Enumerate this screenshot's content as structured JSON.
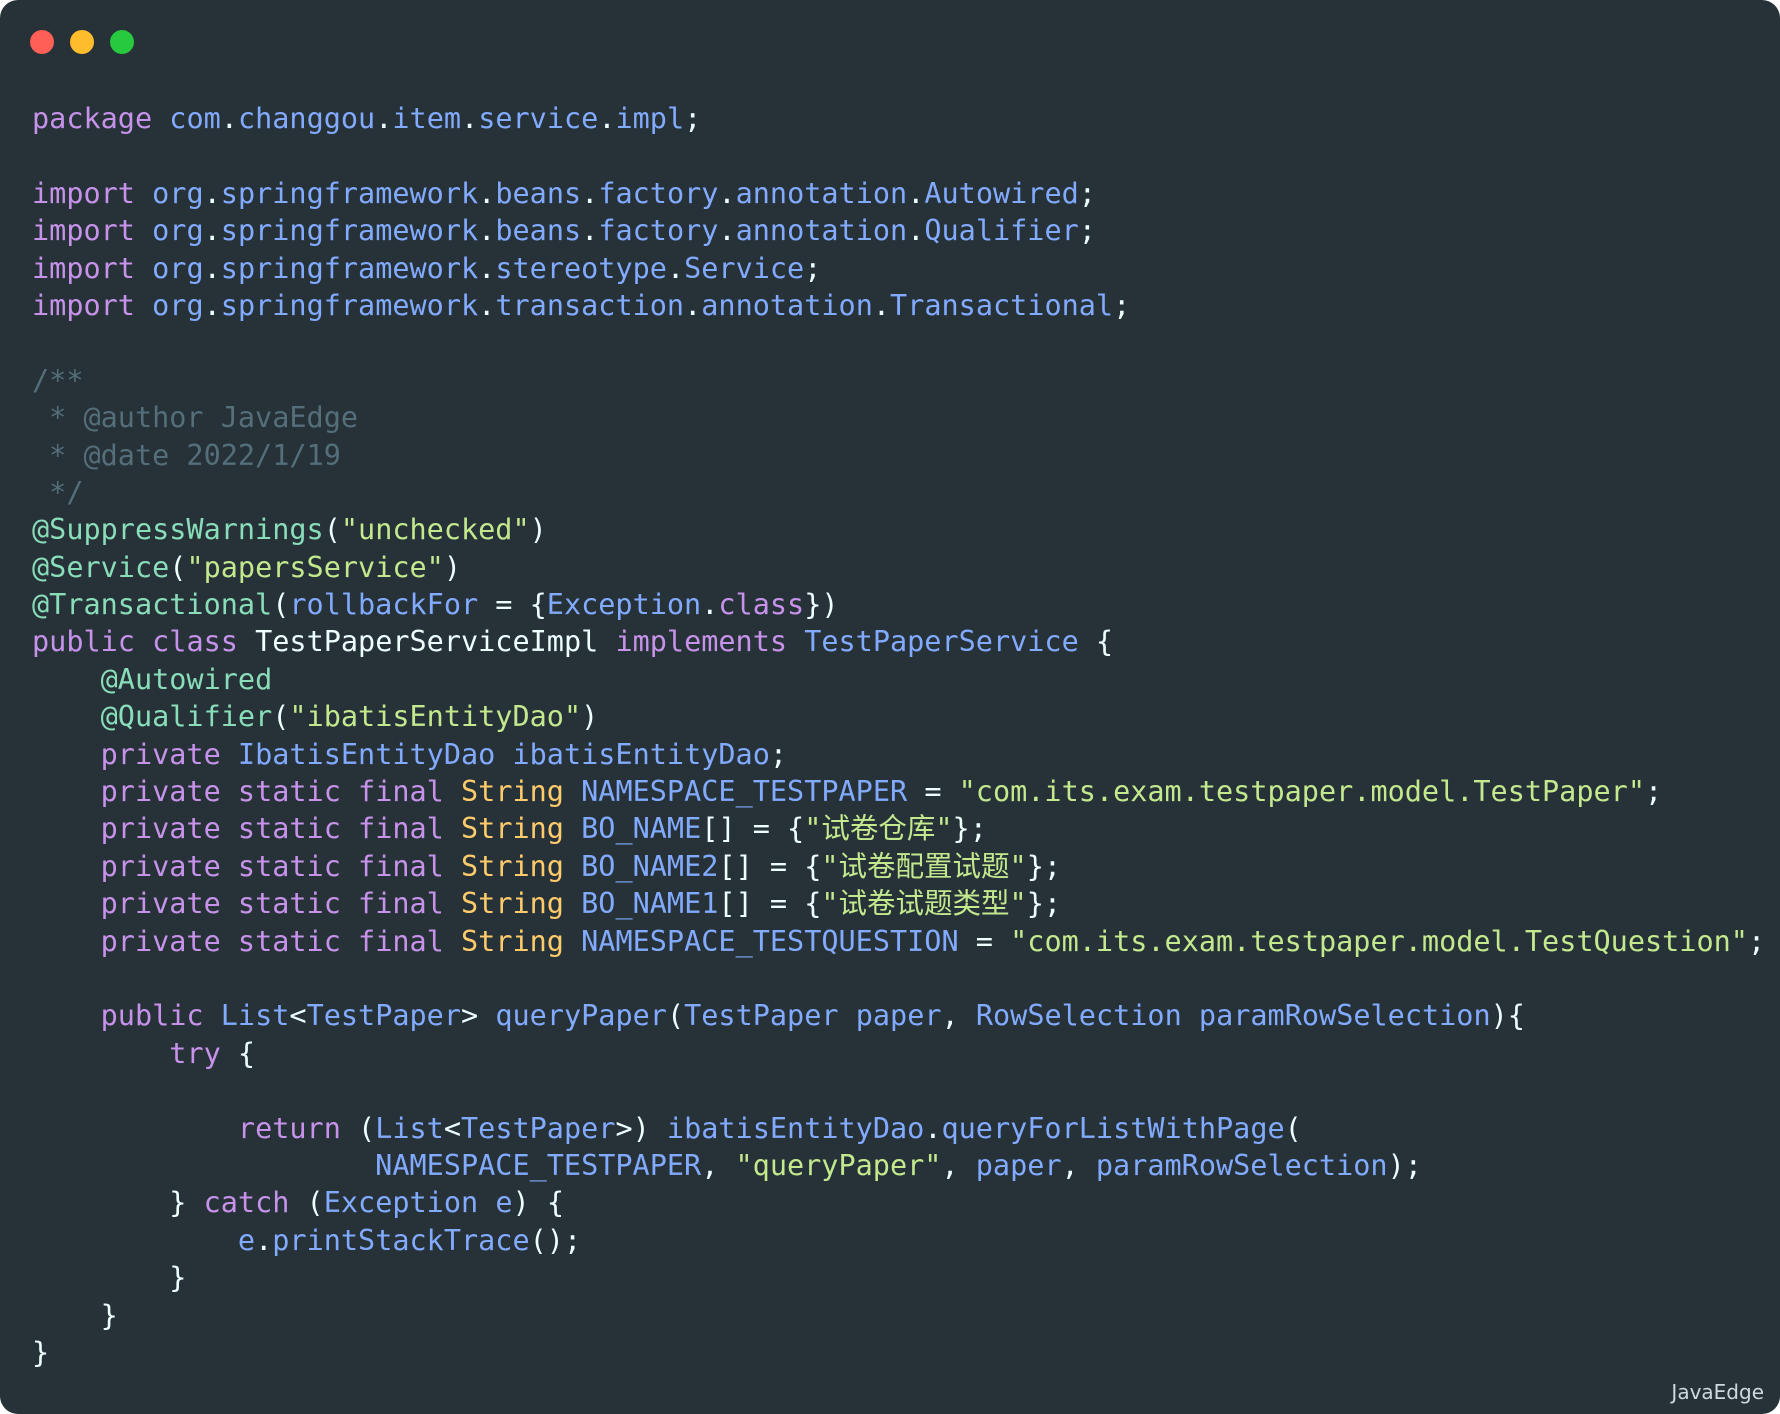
{
  "window": {
    "controls": [
      "close",
      "minimize",
      "maximize"
    ],
    "colors": {
      "background": "#263238",
      "close": "#ff5f56",
      "minimize": "#ffbd2e",
      "maximize": "#27c93f"
    }
  },
  "code": {
    "language": "java",
    "lines": [
      [
        [
          "kw",
          "package"
        ],
        [
          "p",
          " "
        ],
        [
          "pk",
          "com"
        ],
        [
          "p",
          "."
        ],
        [
          "pk",
          "changgou"
        ],
        [
          "p",
          "."
        ],
        [
          "pk",
          "item"
        ],
        [
          "p",
          "."
        ],
        [
          "pk",
          "service"
        ],
        [
          "p",
          "."
        ],
        [
          "pk",
          "impl"
        ],
        [
          "p",
          ";"
        ]
      ],
      [],
      [
        [
          "kw",
          "import"
        ],
        [
          "p",
          " "
        ],
        [
          "pk",
          "org"
        ],
        [
          "p",
          "."
        ],
        [
          "pk",
          "springframework"
        ],
        [
          "p",
          "."
        ],
        [
          "pk",
          "beans"
        ],
        [
          "p",
          "."
        ],
        [
          "pk",
          "factory"
        ],
        [
          "p",
          "."
        ],
        [
          "pk",
          "annotation"
        ],
        [
          "p",
          "."
        ],
        [
          "pk",
          "Autowired"
        ],
        [
          "p",
          ";"
        ]
      ],
      [
        [
          "kw",
          "import"
        ],
        [
          "p",
          " "
        ],
        [
          "pk",
          "org"
        ],
        [
          "p",
          "."
        ],
        [
          "pk",
          "springframework"
        ],
        [
          "p",
          "."
        ],
        [
          "pk",
          "beans"
        ],
        [
          "p",
          "."
        ],
        [
          "pk",
          "factory"
        ],
        [
          "p",
          "."
        ],
        [
          "pk",
          "annotation"
        ],
        [
          "p",
          "."
        ],
        [
          "pk",
          "Qualifier"
        ],
        [
          "p",
          ";"
        ]
      ],
      [
        [
          "kw",
          "import"
        ],
        [
          "p",
          " "
        ],
        [
          "pk",
          "org"
        ],
        [
          "p",
          "."
        ],
        [
          "pk",
          "springframework"
        ],
        [
          "p",
          "."
        ],
        [
          "pk",
          "stereotype"
        ],
        [
          "p",
          "."
        ],
        [
          "pk",
          "Service"
        ],
        [
          "p",
          ";"
        ]
      ],
      [
        [
          "kw",
          "import"
        ],
        [
          "p",
          " "
        ],
        [
          "pk",
          "org"
        ],
        [
          "p",
          "."
        ],
        [
          "pk",
          "springframework"
        ],
        [
          "p",
          "."
        ],
        [
          "pk",
          "transaction"
        ],
        [
          "p",
          "."
        ],
        [
          "pk",
          "annotation"
        ],
        [
          "p",
          "."
        ],
        [
          "pk",
          "Transactional"
        ],
        [
          "p",
          ";"
        ]
      ],
      [],
      [
        [
          "cm",
          "/**"
        ]
      ],
      [
        [
          "cm",
          " * @author JavaEdge"
        ]
      ],
      [
        [
          "cm",
          " * @date 2022/1/19"
        ]
      ],
      [
        [
          "cm",
          " */"
        ]
      ],
      [
        [
          "an",
          "@SuppressWarnings"
        ],
        [
          "p",
          "("
        ],
        [
          "st",
          "\"unchecked\""
        ],
        [
          "p",
          ")"
        ]
      ],
      [
        [
          "an",
          "@Service"
        ],
        [
          "p",
          "("
        ],
        [
          "st",
          "\"papersService\""
        ],
        [
          "p",
          ")"
        ]
      ],
      [
        [
          "an",
          "@Transactional"
        ],
        [
          "p",
          "("
        ],
        [
          "id",
          "rollbackFor"
        ],
        [
          "p",
          " = {"
        ],
        [
          "id",
          "Exception"
        ],
        [
          "p",
          "."
        ],
        [
          "kw",
          "class"
        ],
        [
          "p",
          "})"
        ]
      ],
      [
        [
          "kw",
          "public"
        ],
        [
          "p",
          " "
        ],
        [
          "kw",
          "class"
        ],
        [
          "p",
          " "
        ],
        [
          "cl",
          "TestPaperServiceImpl"
        ],
        [
          "p",
          " "
        ],
        [
          "kw",
          "implements"
        ],
        [
          "p",
          " "
        ],
        [
          "id",
          "TestPaperService"
        ],
        [
          "p",
          " {"
        ]
      ],
      [
        [
          "p",
          "    "
        ],
        [
          "an",
          "@Autowired"
        ]
      ],
      [
        [
          "p",
          "    "
        ],
        [
          "an",
          "@Qualifier"
        ],
        [
          "p",
          "("
        ],
        [
          "st",
          "\"ibatisEntityDao\""
        ],
        [
          "p",
          ")"
        ]
      ],
      [
        [
          "p",
          "    "
        ],
        [
          "kw",
          "private"
        ],
        [
          "p",
          " "
        ],
        [
          "id",
          "IbatisEntityDao"
        ],
        [
          "p",
          " "
        ],
        [
          "id",
          "ibatisEntityDao"
        ],
        [
          "p",
          ";"
        ]
      ],
      [
        [
          "p",
          "    "
        ],
        [
          "kw",
          "private"
        ],
        [
          "p",
          " "
        ],
        [
          "kw",
          "static"
        ],
        [
          "p",
          " "
        ],
        [
          "kw",
          "final"
        ],
        [
          "p",
          " "
        ],
        [
          "ty",
          "String"
        ],
        [
          "p",
          " "
        ],
        [
          "id",
          "NAMESPACE_TESTPAPER"
        ],
        [
          "p",
          " = "
        ],
        [
          "st",
          "\"com.its.exam.testpaper.model.TestPaper\""
        ],
        [
          "p",
          ";"
        ]
      ],
      [
        [
          "p",
          "    "
        ],
        [
          "kw",
          "private"
        ],
        [
          "p",
          " "
        ],
        [
          "kw",
          "static"
        ],
        [
          "p",
          " "
        ],
        [
          "kw",
          "final"
        ],
        [
          "p",
          " "
        ],
        [
          "ty",
          "String"
        ],
        [
          "p",
          " "
        ],
        [
          "id",
          "BO_NAME"
        ],
        [
          "p",
          "[] = {"
        ],
        [
          "st",
          "\"试卷仓库\""
        ],
        [
          "p",
          "};"
        ]
      ],
      [
        [
          "p",
          "    "
        ],
        [
          "kw",
          "private"
        ],
        [
          "p",
          " "
        ],
        [
          "kw",
          "static"
        ],
        [
          "p",
          " "
        ],
        [
          "kw",
          "final"
        ],
        [
          "p",
          " "
        ],
        [
          "ty",
          "String"
        ],
        [
          "p",
          " "
        ],
        [
          "id",
          "BO_NAME2"
        ],
        [
          "p",
          "[] = {"
        ],
        [
          "st",
          "\"试卷配置试题\""
        ],
        [
          "p",
          "};"
        ]
      ],
      [
        [
          "p",
          "    "
        ],
        [
          "kw",
          "private"
        ],
        [
          "p",
          " "
        ],
        [
          "kw",
          "static"
        ],
        [
          "p",
          " "
        ],
        [
          "kw",
          "final"
        ],
        [
          "p",
          " "
        ],
        [
          "ty",
          "String"
        ],
        [
          "p",
          " "
        ],
        [
          "id",
          "BO_NAME1"
        ],
        [
          "p",
          "[] = {"
        ],
        [
          "st",
          "\"试卷试题类型\""
        ],
        [
          "p",
          "};"
        ]
      ],
      [
        [
          "p",
          "    "
        ],
        [
          "kw",
          "private"
        ],
        [
          "p",
          " "
        ],
        [
          "kw",
          "static"
        ],
        [
          "p",
          " "
        ],
        [
          "kw",
          "final"
        ],
        [
          "p",
          " "
        ],
        [
          "ty",
          "String"
        ],
        [
          "p",
          " "
        ],
        [
          "id",
          "NAMESPACE_TESTQUESTION"
        ],
        [
          "p",
          " = "
        ],
        [
          "st",
          "\"com.its.exam.testpaper.model.TestQuestion\""
        ],
        [
          "p",
          ";"
        ]
      ],
      [],
      [
        [
          "p",
          "    "
        ],
        [
          "kw",
          "public"
        ],
        [
          "p",
          " "
        ],
        [
          "id",
          "List"
        ],
        [
          "p",
          "<"
        ],
        [
          "id",
          "TestPaper"
        ],
        [
          "p",
          "> "
        ],
        [
          "id",
          "queryPaper"
        ],
        [
          "p",
          "("
        ],
        [
          "id",
          "TestPaper"
        ],
        [
          "p",
          " "
        ],
        [
          "id",
          "paper"
        ],
        [
          "p",
          ", "
        ],
        [
          "id",
          "RowSelection"
        ],
        [
          "p",
          " "
        ],
        [
          "id",
          "paramRowSelection"
        ],
        [
          "p",
          "){"
        ]
      ],
      [
        [
          "p",
          "        "
        ],
        [
          "kw",
          "try"
        ],
        [
          "p",
          " {"
        ]
      ],
      [],
      [
        [
          "p",
          "            "
        ],
        [
          "kw",
          "return"
        ],
        [
          "p",
          " ("
        ],
        [
          "id",
          "List"
        ],
        [
          "p",
          "<"
        ],
        [
          "id",
          "TestPaper"
        ],
        [
          "p",
          ">) "
        ],
        [
          "id",
          "ibatisEntityDao"
        ],
        [
          "p",
          "."
        ],
        [
          "id",
          "queryForListWithPage"
        ],
        [
          "p",
          "("
        ]
      ],
      [
        [
          "p",
          "                    "
        ],
        [
          "id",
          "NAMESPACE_TESTPAPER"
        ],
        [
          "p",
          ", "
        ],
        [
          "st",
          "\"queryPaper\""
        ],
        [
          "p",
          ", "
        ],
        [
          "id",
          "paper"
        ],
        [
          "p",
          ", "
        ],
        [
          "id",
          "paramRowSelection"
        ],
        [
          "p",
          ");"
        ]
      ],
      [
        [
          "p",
          "        } "
        ],
        [
          "kw",
          "catch"
        ],
        [
          "p",
          " ("
        ],
        [
          "id",
          "Exception"
        ],
        [
          "p",
          " "
        ],
        [
          "id",
          "e"
        ],
        [
          "p",
          ") {"
        ]
      ],
      [
        [
          "p",
          "            "
        ],
        [
          "id",
          "e"
        ],
        [
          "p",
          "."
        ],
        [
          "id",
          "printStackTrace"
        ],
        [
          "p",
          "();"
        ]
      ],
      [
        [
          "p",
          "        }"
        ]
      ],
      [
        [
          "p",
          "    }"
        ]
      ],
      [
        [
          "p",
          "}"
        ]
      ]
    ]
  },
  "watermark": "JavaEdge"
}
